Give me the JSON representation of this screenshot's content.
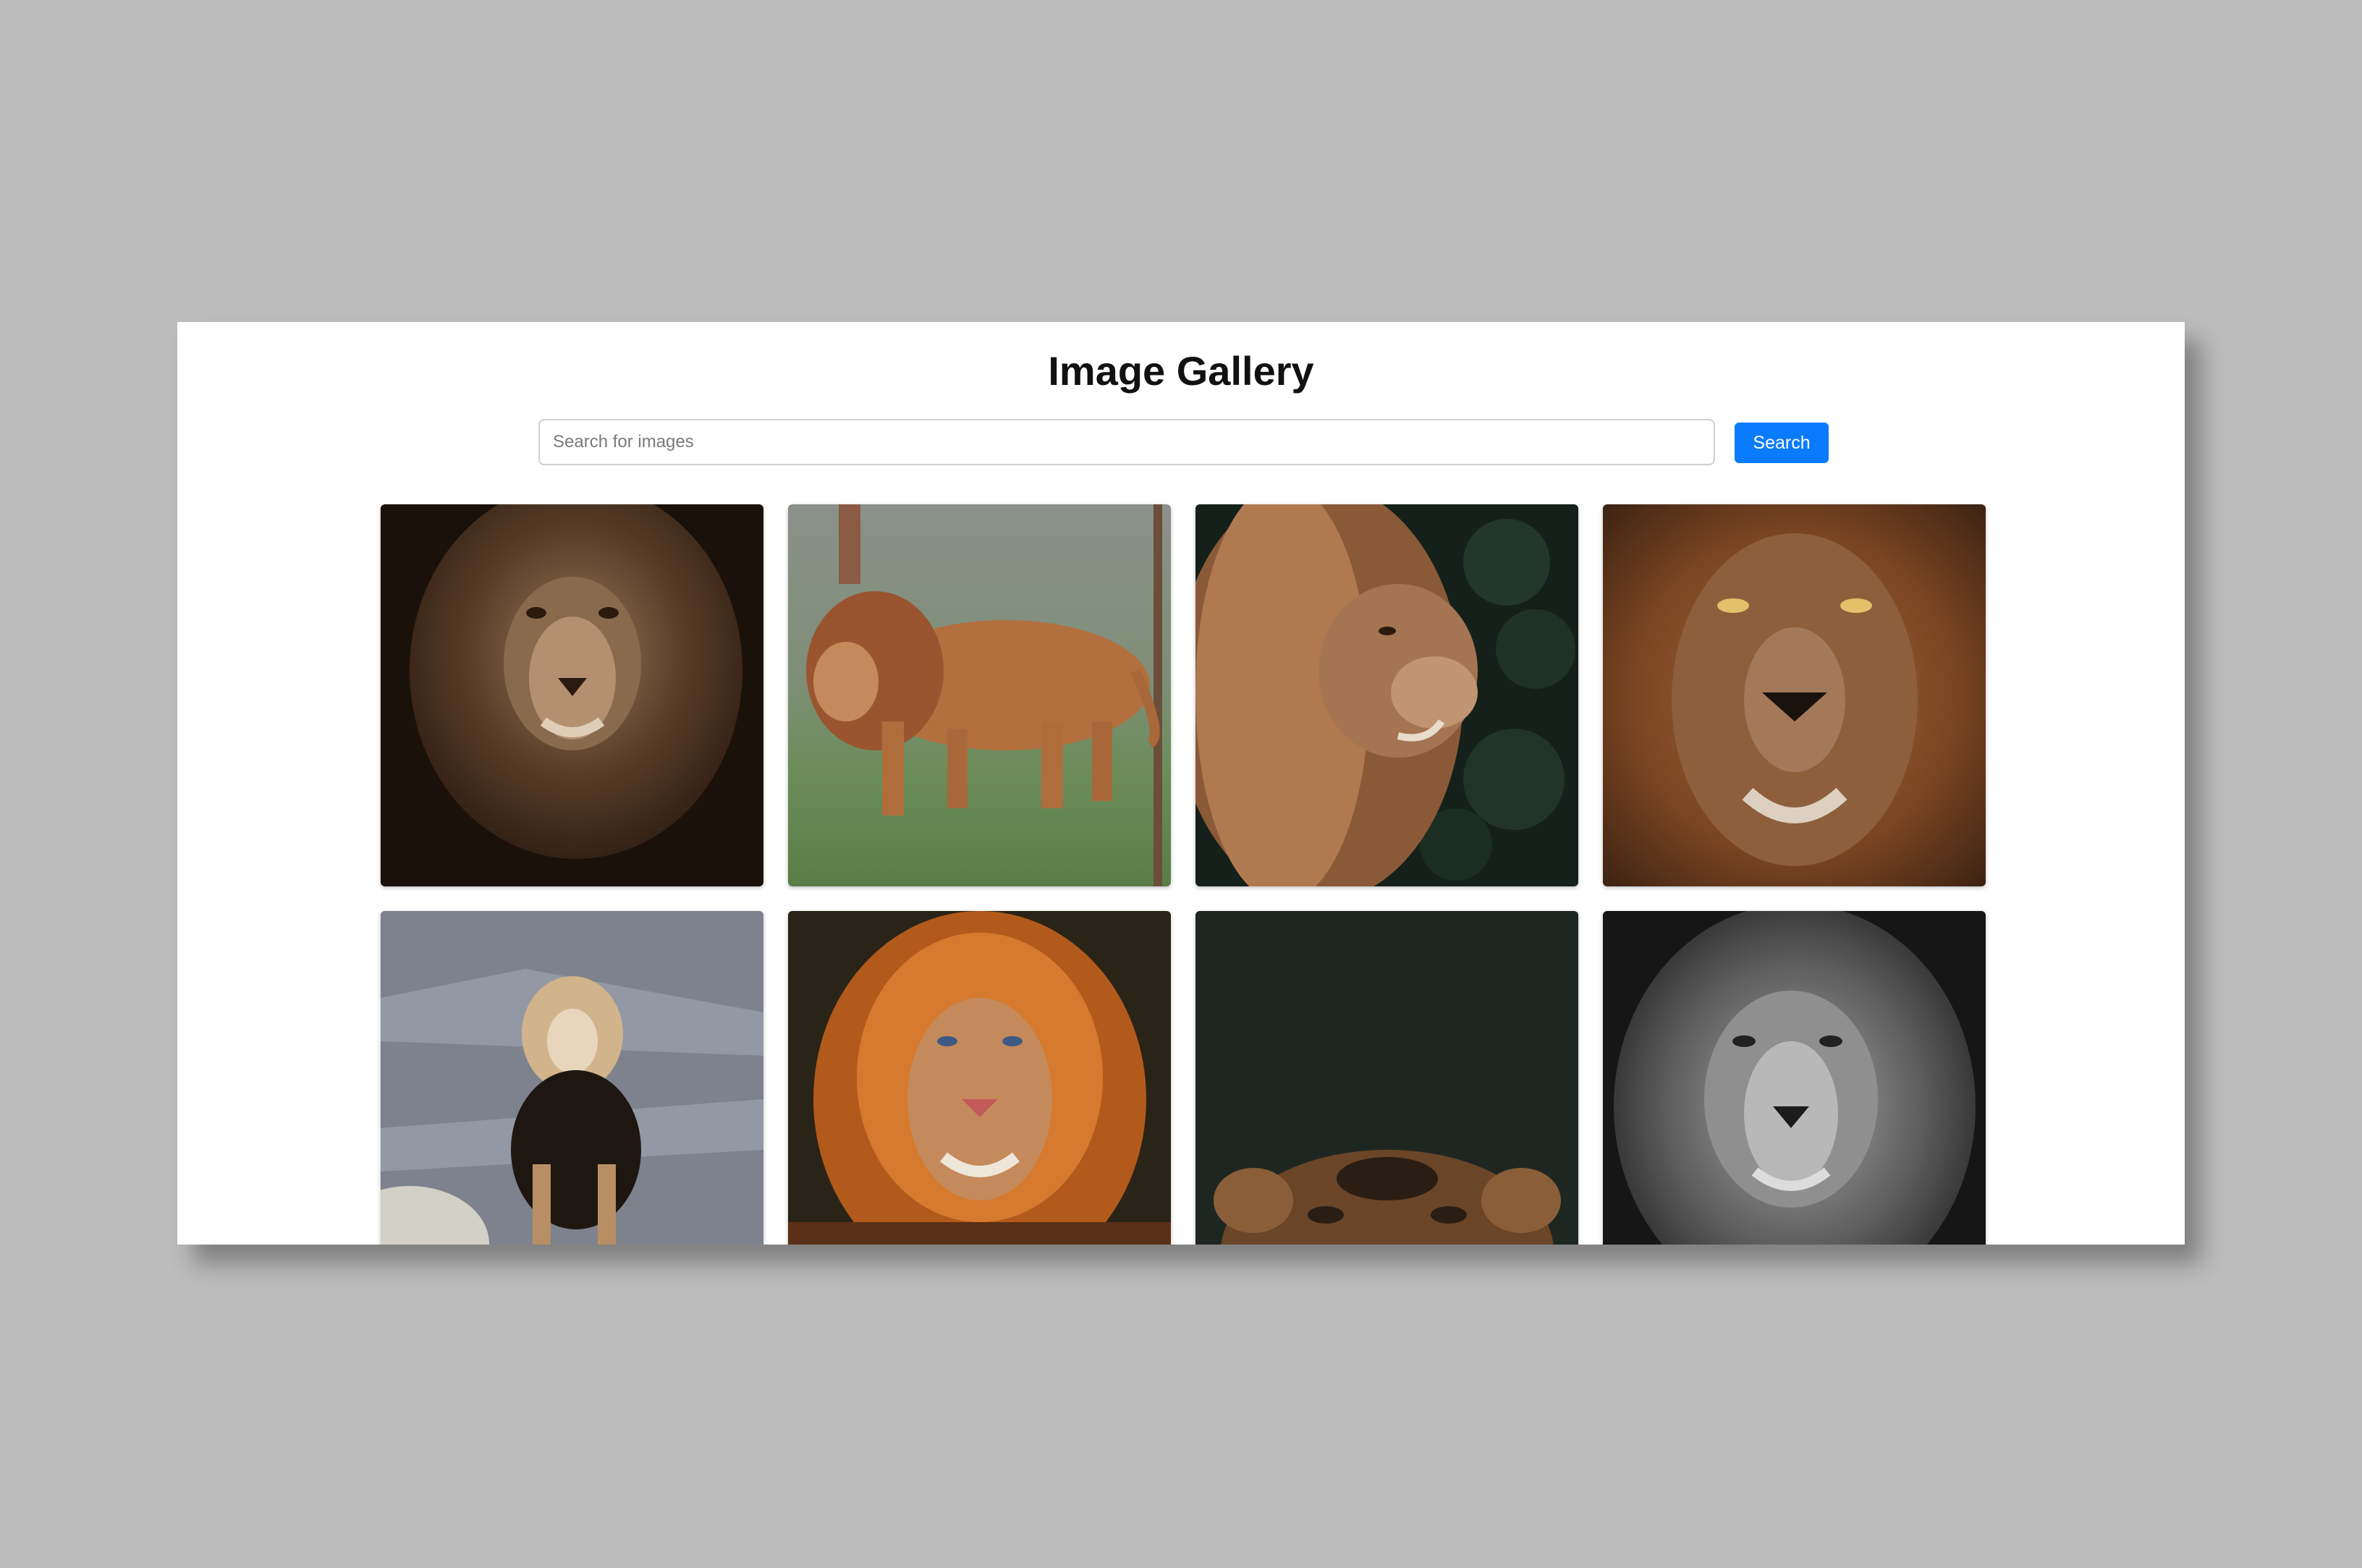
{
  "page": {
    "title": "Image Gallery"
  },
  "search": {
    "placeholder": "Search for images",
    "value": "",
    "button_label": "Search"
  },
  "colors": {
    "accent": "#0a7bfd",
    "window_bg": "#ffffff",
    "desktop_bg": "#bcbcbc"
  },
  "gallery": {
    "images": [
      {
        "alt": "lion portrait sepia",
        "palette": "sepia"
      },
      {
        "alt": "lion walking on grass",
        "palette": "grass"
      },
      {
        "alt": "lion profile with leaves",
        "palette": "leaves"
      },
      {
        "alt": "lion face close-up",
        "palette": "amber"
      },
      {
        "alt": "lion standing on rocks",
        "palette": "rocks"
      },
      {
        "alt": "orange lion portrait",
        "palette": "orange"
      },
      {
        "alt": "lion looking up",
        "palette": "dark"
      },
      {
        "alt": "black and white lion",
        "palette": "mono"
      }
    ]
  }
}
